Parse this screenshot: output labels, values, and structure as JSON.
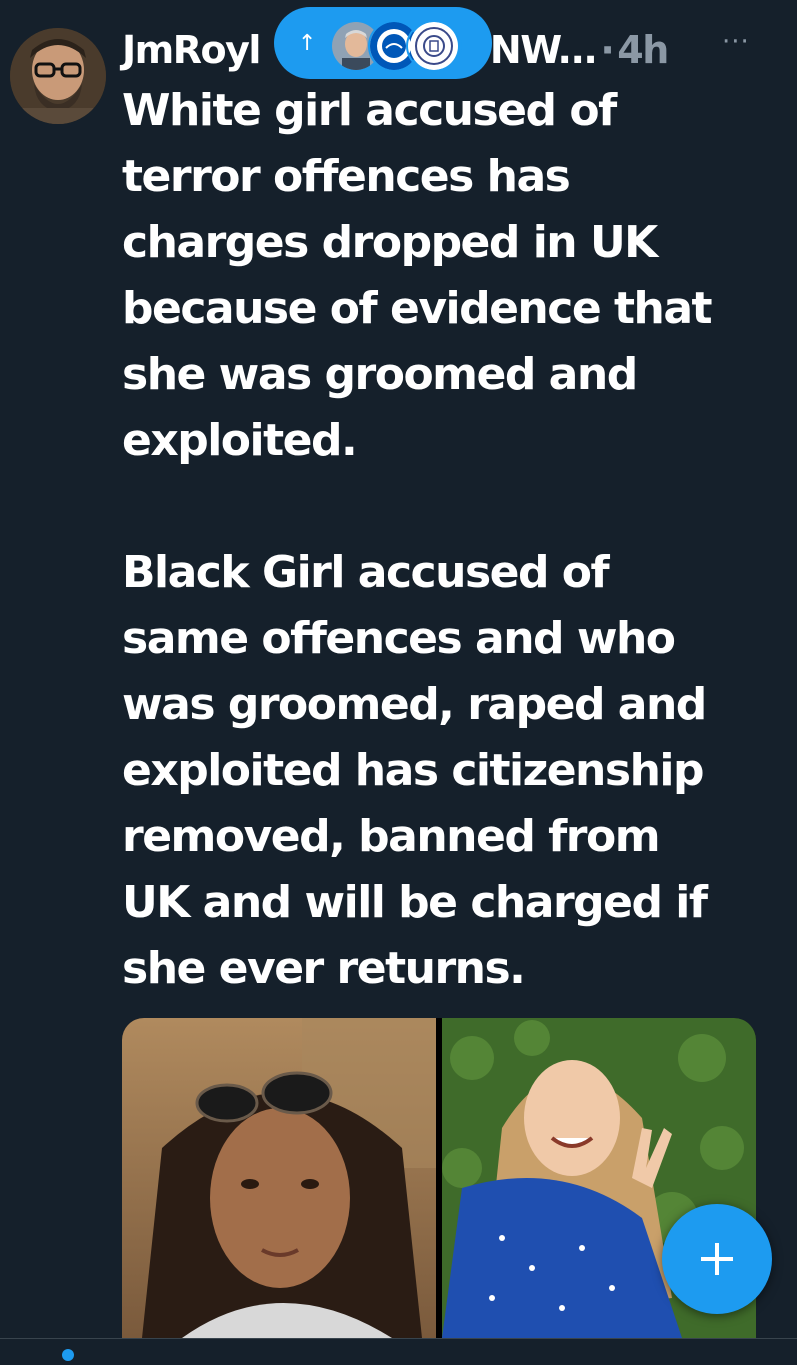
{
  "tweet": {
    "author_name": "JmRoyl",
    "author_handle": "NW...",
    "separator": "·",
    "time": "4h",
    "more": "···",
    "text": "White girl accused of\nterror offences has\ncharges dropped in UK\nbecause of evidence that\nshe was groomed and\nexploited.\n\nBlack Girl accused of\nsame offences and who\nwas groomed, raped and\nexploited has citizenship\nremoved, banned from\nUK and will be charged if\nshe ever returns."
  },
  "new_tweets_pill": {
    "arrow": "↑"
  },
  "fab": {
    "icon": "plus-icon"
  },
  "colors": {
    "background": "#15202b",
    "accent": "#1d9bf0",
    "secondary_text": "#8b98a5"
  }
}
